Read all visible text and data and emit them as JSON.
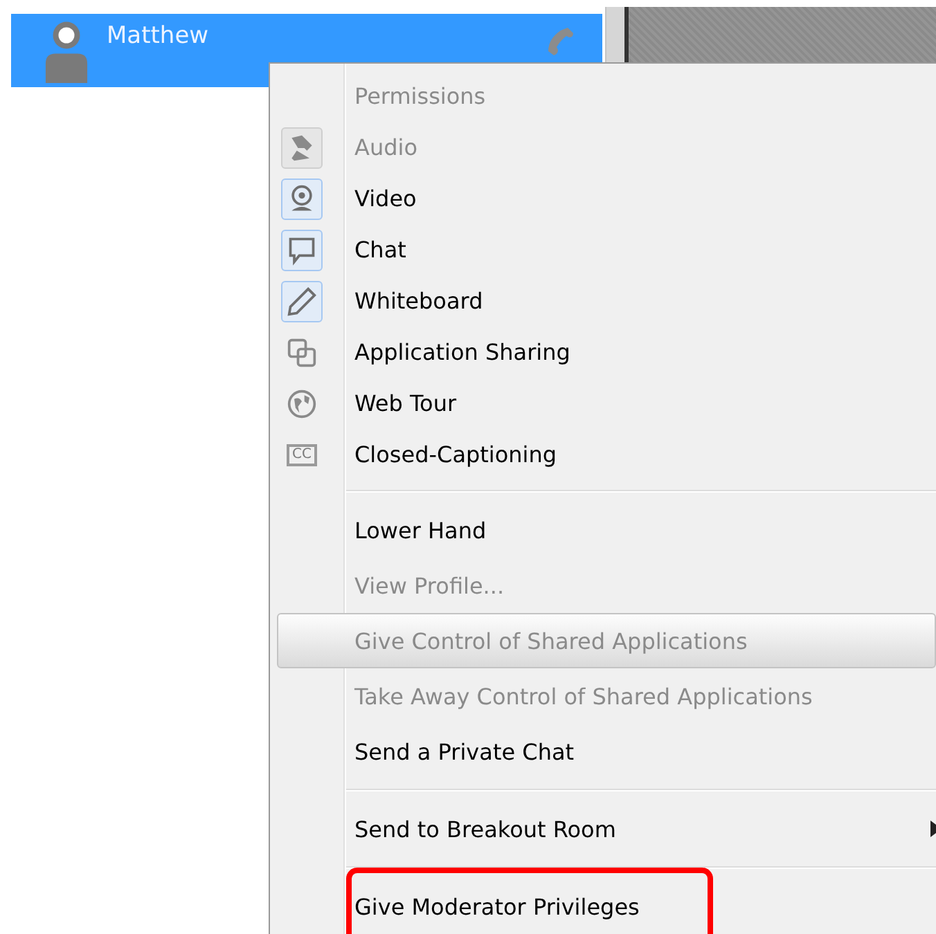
{
  "participant": {
    "name": "Matthew"
  },
  "menu": {
    "sections": [
      {
        "items": [
          {
            "kind": "header",
            "label": "Permissions",
            "disabled": true,
            "highlighted": false,
            "annotated": false
          },
          {
            "kind": "permission",
            "label": "Audio",
            "checked": true,
            "disabled": true,
            "highlighted": false,
            "annotated": false
          },
          {
            "kind": "permission",
            "label": "Video",
            "checked": true,
            "disabled": false,
            "highlighted": false,
            "annotated": false
          },
          {
            "kind": "permission",
            "label": "Chat",
            "checked": true,
            "disabled": false,
            "highlighted": false,
            "annotated": false
          },
          {
            "kind": "permission",
            "label": "Whiteboard",
            "checked": true,
            "disabled": false,
            "highlighted": false,
            "annotated": false
          },
          {
            "kind": "permission",
            "label": "Application Sharing",
            "checked": false,
            "disabled": false,
            "highlighted": false,
            "annotated": false
          },
          {
            "kind": "permission",
            "label": "Web Tour",
            "checked": false,
            "disabled": false,
            "highlighted": false,
            "annotated": false
          },
          {
            "kind": "permission",
            "icon_text": "CC",
            "label": "Closed-Captioning",
            "checked": false,
            "disabled": false,
            "highlighted": false,
            "annotated": false
          }
        ]
      },
      {
        "items": [
          {
            "kind": "command",
            "label": "Lower Hand",
            "disabled": false,
            "highlighted": false,
            "annotated": false
          },
          {
            "kind": "command",
            "label": "View Profile...",
            "disabled": true,
            "highlighted": false,
            "annotated": false
          },
          {
            "kind": "command",
            "label": "Give Control of Shared Applications",
            "disabled": true,
            "highlighted": true,
            "annotated": false
          },
          {
            "kind": "command",
            "label": "Take Away Control of Shared Applications",
            "disabled": true,
            "highlighted": false,
            "annotated": false
          },
          {
            "kind": "command",
            "label": "Send a Private Chat",
            "disabled": false,
            "highlighted": false,
            "annotated": false
          }
        ]
      },
      {
        "items": [
          {
            "kind": "submenu",
            "label": "Send to Breakout Room",
            "disabled": false,
            "highlighted": false,
            "annotated": false
          }
        ]
      },
      {
        "items": [
          {
            "kind": "command",
            "label": "Give Moderator Privileges",
            "disabled": false,
            "highlighted": false,
            "annotated": true
          }
        ]
      }
    ]
  }
}
